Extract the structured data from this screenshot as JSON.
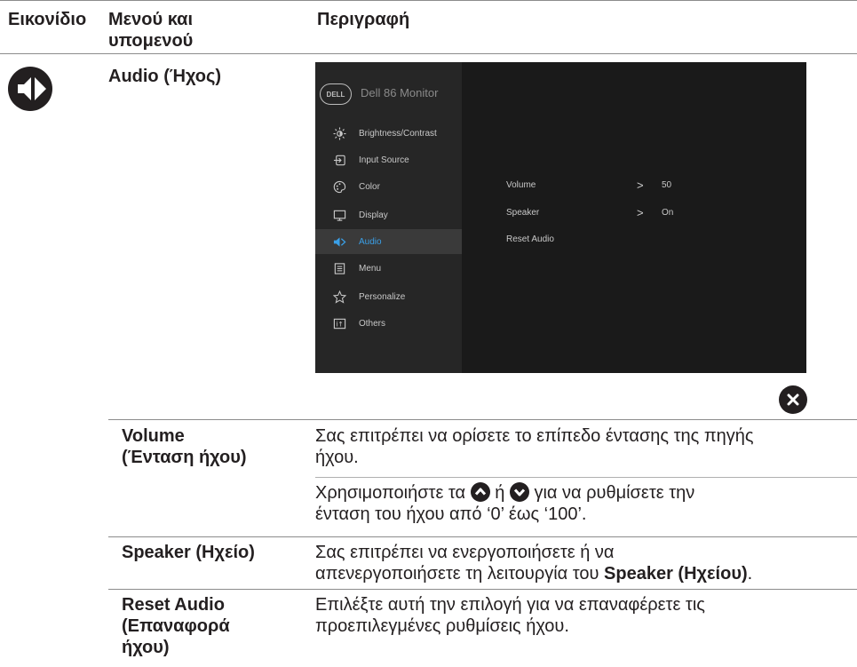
{
  "header": {
    "col_icon": "Εικονίδιο",
    "col_menu_line1": "Μενού και",
    "col_menu_line2": "υπομενού",
    "col_desc": "Περιγραφή"
  },
  "section": {
    "icon": "audio-speaker-icon",
    "title": "Audio (Ήχος)"
  },
  "osd": {
    "brand": "DELL",
    "title": "Dell 86 Monitor",
    "menu": [
      {
        "label": "Brightness/Contrast",
        "icon": "brightness-icon"
      },
      {
        "label": "Input Source",
        "icon": "input-source-icon"
      },
      {
        "label": "Color",
        "icon": "color-palette-icon"
      },
      {
        "label": "Display",
        "icon": "display-icon"
      },
      {
        "label": "Audio",
        "icon": "audio-icon",
        "active": true
      },
      {
        "label": "Menu",
        "icon": "menu-icon"
      },
      {
        "label": "Personalize",
        "icon": "star-icon"
      },
      {
        "label": "Others",
        "icon": "others-icon"
      }
    ],
    "rows": [
      {
        "label": "Volume",
        "value": "50"
      },
      {
        "label": "Speaker",
        "value": "On"
      },
      {
        "label": "Reset Audio",
        "value": ""
      }
    ],
    "accent_color": "#3aa0e8",
    "close_icon": "close-icon"
  },
  "rows": [
    {
      "name_line1": "Volume",
      "name_line2": "(Ένταση ήχου)",
      "desc1_line1": "Σας επιτρέπει να ορίσετε το επίπεδο έντασης της πηγής",
      "desc1_line2": "ήχου.",
      "desc2_pre": "Χρησιμοποιήστε τα",
      "desc2_or": "ή",
      "desc2_post": "για να ρυθμίσετε την",
      "desc2_line2": "ένταση του ήχου από ‘0’ έως ‘100’.",
      "up_icon": "up-arrow-button-icon",
      "down_icon": "down-arrow-button-icon"
    },
    {
      "name_line1": "Speaker (Ηχείο)",
      "desc_line1": "Σας επιτρέπει να ενεργοποιήσετε ή να",
      "desc_line2_pre": "απενεργοποιήσετε τη λειτουργία του ",
      "desc_line2_bold": "Speaker (Ηχείου)",
      "desc_line2_post": "."
    },
    {
      "name_line1": "Reset Audio",
      "name_line2": "(Επαναφορά",
      "name_line3": "ήχου)",
      "desc_line1": "Επιλέξτε αυτή την επιλογή για να επαναφέρετε τις",
      "desc_line2": "προεπιλεγμένες ρυθμίσεις ήχου."
    }
  ]
}
